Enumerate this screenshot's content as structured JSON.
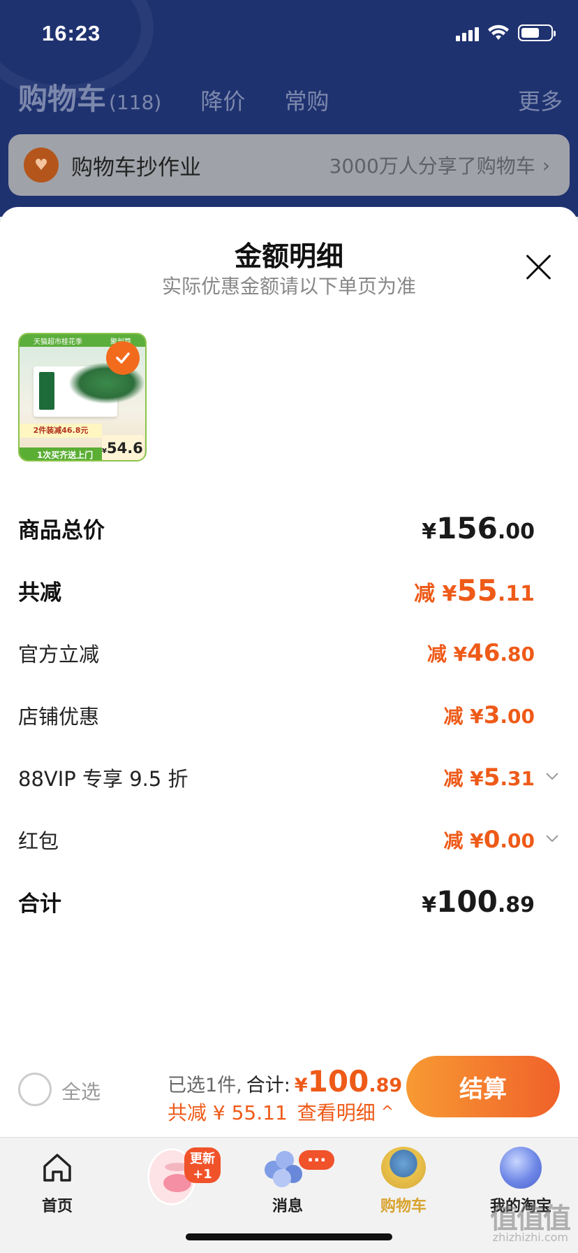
{
  "status": {
    "time": "16:23"
  },
  "cart": {
    "title": "购物车",
    "count": "(118)",
    "tabs": [
      "降价",
      "常购"
    ],
    "more": "更多",
    "homework": {
      "title": "购物车抄作业",
      "subtitle": "3000万人分享了购物车",
      "chevron": "›"
    }
  },
  "sheet": {
    "title": "金额明细",
    "subtitle": "实际优惠金额请以下单页为准",
    "product": {
      "top_left": "天猫超市桂花季",
      "top_right": "聚划算",
      "promo": "2件装减46.8元",
      "bottom": "1次买齐送上门",
      "price_currency": "¥",
      "price": "54.6",
      "checked": true
    },
    "rows": [
      {
        "label": "商品总价",
        "prefix": "",
        "currency": "¥",
        "int": "156",
        "dec": ".00",
        "style": "total"
      },
      {
        "label": "共减",
        "prefix": "减 ",
        "currency": "¥",
        "int": "55",
        "dec": ".11",
        "style": "discount-main"
      },
      {
        "label": "官方立减",
        "prefix": "减 ",
        "currency": "¥",
        "int": "46",
        "dec": ".80",
        "style": "discount"
      },
      {
        "label": "店铺优惠",
        "prefix": "减 ",
        "currency": "¥",
        "int": "3",
        "dec": ".00",
        "style": "discount"
      },
      {
        "label": "88VIP 专享 9.5 折",
        "prefix": "减 ",
        "currency": "¥",
        "int": "5",
        "dec": ".31",
        "style": "discount",
        "expandable": true
      },
      {
        "label": "红包",
        "prefix": "减 ",
        "currency": "¥",
        "int": "0",
        "dec": ".00",
        "style": "discount",
        "expandable": true
      },
      {
        "label": "合计",
        "prefix": "",
        "currency": "¥",
        "int": "100",
        "dec": ".89",
        "style": "total"
      }
    ]
  },
  "checkout": {
    "select_all": "全选",
    "selected_text": "已选1件,",
    "total_label": "合计:",
    "total_currency": "¥",
    "total_int": "100",
    "total_dec": ".89",
    "discount_text": "共减 ¥ 55.11",
    "view_detail": "查看明细",
    "caret": "^",
    "pay_button": "结算"
  },
  "tabbar": {
    "items": [
      {
        "label": "首页",
        "icon": "home-icon"
      },
      {
        "label": "",
        "icon": "pig-avatar-icon",
        "badge": "更新+1"
      },
      {
        "label": "消息",
        "icon": "message-icon",
        "badge": "···"
      },
      {
        "label": "购物车",
        "icon": "cart-icon",
        "active": true
      },
      {
        "label": "我的淘宝",
        "icon": "my-taobao-icon"
      }
    ]
  },
  "watermark": {
    "text": "值值值",
    "sub": "zhizhizhi.com"
  },
  "colors": {
    "accent": "#ee5a18",
    "header_bg": "#1f3270",
    "active_tab": "#d8a32e"
  }
}
